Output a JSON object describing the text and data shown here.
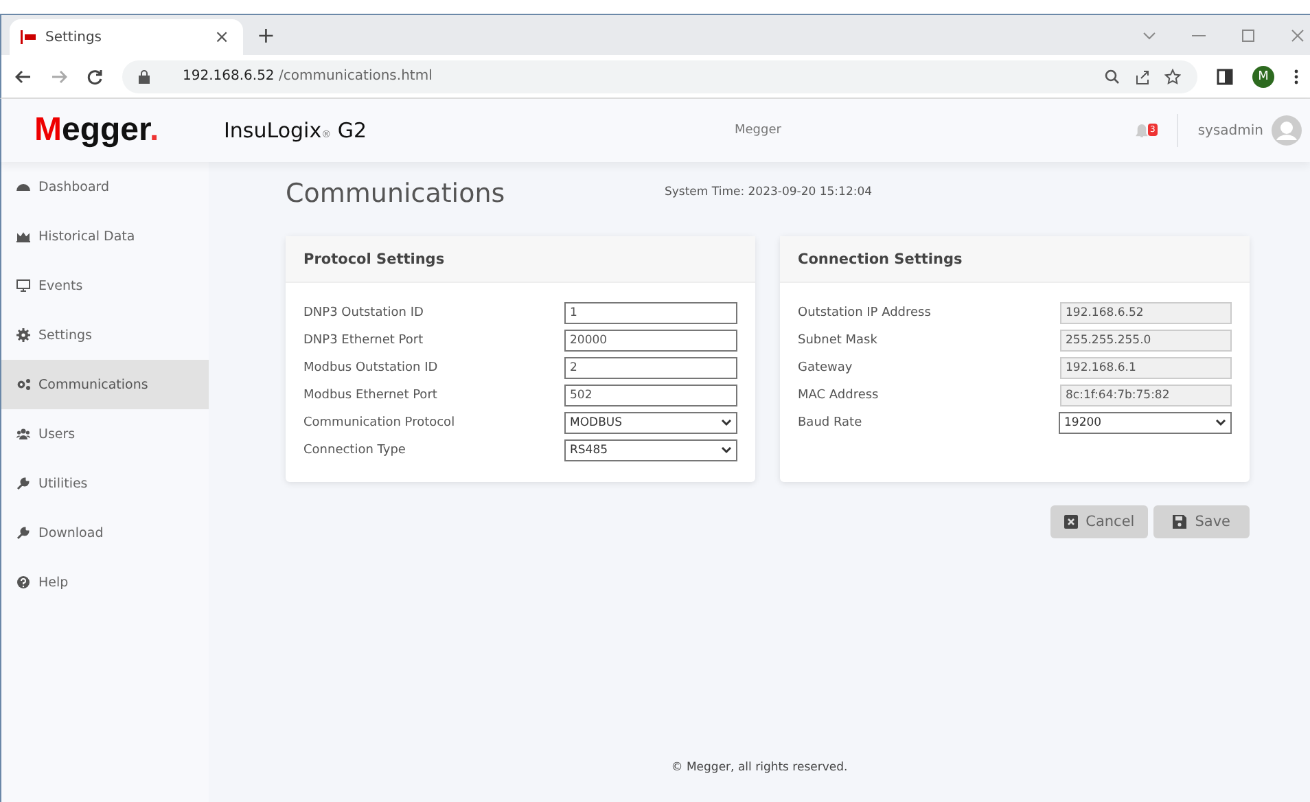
{
  "browser": {
    "tab_title": "Settings",
    "tab_close": "×",
    "new_tab": "+",
    "url_host": "192.168.6.52",
    "url_path": " /communications.html",
    "profile": "M"
  },
  "header": {
    "logo": "Megger",
    "logo_dot": ".",
    "product": "InsuLogix",
    "product_mark": "®",
    "product_suffix": "G2",
    "center": "Megger",
    "notifications": "3",
    "user": "sysadmin"
  },
  "sidebar": {
    "items": [
      {
        "label": "Dashboard",
        "selected": false
      },
      {
        "label": "Historical Data",
        "selected": false
      },
      {
        "label": "Events",
        "selected": false
      },
      {
        "label": "Settings",
        "selected": false
      },
      {
        "label": "Communications",
        "selected": true
      },
      {
        "label": "Users",
        "selected": false
      },
      {
        "label": "Utilities",
        "selected": false
      },
      {
        "label": "Download",
        "selected": false
      },
      {
        "label": "Help",
        "selected": false
      }
    ]
  },
  "page": {
    "title": "Communications",
    "system_time": "System Time: 2023-09-20 15:12:04"
  },
  "cards": [
    {
      "title": "Protocol Settings",
      "fields": [
        {
          "label": "DNP3 Outstation ID",
          "kind": "text",
          "value": "1"
        },
        {
          "label": "DNP3 Ethernet Port",
          "kind": "text",
          "value": "20000"
        },
        {
          "label": "Modbus Outstation ID",
          "kind": "text",
          "value": "2"
        },
        {
          "label": "Modbus Ethernet Port",
          "kind": "text",
          "value": "502"
        },
        {
          "label": "Communication Protocol",
          "kind": "select",
          "value": "MODBUS"
        },
        {
          "label": "Connection Type",
          "kind": "select",
          "value": "RS485"
        }
      ]
    },
    {
      "title": "Connection Settings",
      "fields": [
        {
          "label": "Outstation IP Address",
          "kind": "readonly",
          "value": "192.168.6.52"
        },
        {
          "label": "Subnet Mask",
          "kind": "readonly",
          "value": "255.255.255.0"
        },
        {
          "label": "Gateway",
          "kind": "readonly",
          "value": "192.168.6.1"
        },
        {
          "label": "MAC Address",
          "kind": "readonly",
          "value": "8c:1f:64:7b:75:82"
        },
        {
          "label": "Baud Rate",
          "kind": "select",
          "value": "19200"
        }
      ]
    }
  ],
  "buttons": [
    {
      "label": "Cancel",
      "kind": "cancel"
    },
    {
      "label": "Save",
      "kind": "save"
    }
  ],
  "footer": "© Megger, all rights reserved."
}
